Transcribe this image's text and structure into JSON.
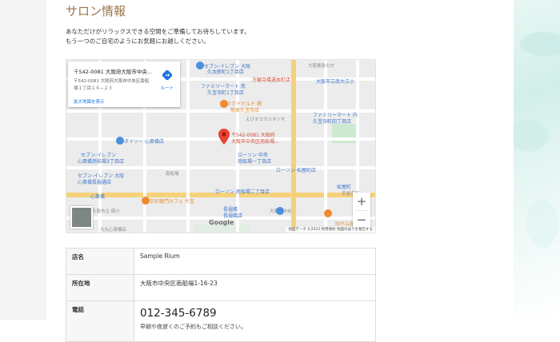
{
  "page": {
    "title": "サロン情報",
    "intro_line1": "あなただけがリラックスできる空間をご準備してお待ちしています。",
    "intro_line2": "もう一つのご自宅のようにお気軽にお越しください。"
  },
  "map": {
    "info_card": {
      "title": "〒542-0081 大阪府大阪市中央...",
      "address": "〒542-0081 大阪府大阪市中央区南船場１丁目１６−２３",
      "route_label": "ルート",
      "larger_map_link": "拡大地図を表示"
    },
    "marker_label_line1": "〒542-0081 大阪府",
    "marker_label_line2": "大阪市中央区南船場...",
    "labels": [
      "セブン-イレブン 大阪",
      "久太郎町1丁目店",
      "大阪東急の方",
      "ファミリーマート 南",
      "久宝寺町1丁目店",
      "万願寺橋通本町店",
      "マクドナルド 堺",
      "筋南久宝寺店",
      "えびすヨガスタジオ",
      "大阪市立南大江小",
      "ファミリーマート 内",
      "久宝寺町四丁目店",
      "ダイソー 心斎橋店",
      "セブン-イレブン",
      "心斎橋南船場3丁目店",
      "ローソン 中央",
      "南船場一丁目店",
      "ローソン 松屋町店",
      "松屋町",
      "セブン-イレブン 大阪",
      "心斎橋長堀通店",
      "長堀橋",
      "ローソン 南船場二丁目店",
      "大阪市中央",
      "南船場",
      "心斎橋",
      "安堂寺町",
      "旧ヤム邸",
      "大阪市立 南小",
      "大丸心斎橋店",
      "宗右衛門カフェ 大宝",
      "長堀橋店"
    ],
    "google_logo": "Google",
    "attribution": "地図データ ©2023 利用規約 地図の誤りを報告する",
    "zoom_in": "+",
    "zoom_out": "−"
  },
  "salon_table": {
    "rows": [
      {
        "label": "店名",
        "value": "Sample Rium"
      },
      {
        "label": "所在地",
        "value": "大阪市中央区南船場1-16-23"
      },
      {
        "label": "電話",
        "phone": "012-345-6789",
        "note": "早朝や夜遅くのご予約もご相談ください。"
      }
    ]
  },
  "colors": {
    "title": "#9c7449",
    "link": "#1a73e8",
    "marker": "#ea4335",
    "accent_bg": "#d3efea"
  }
}
